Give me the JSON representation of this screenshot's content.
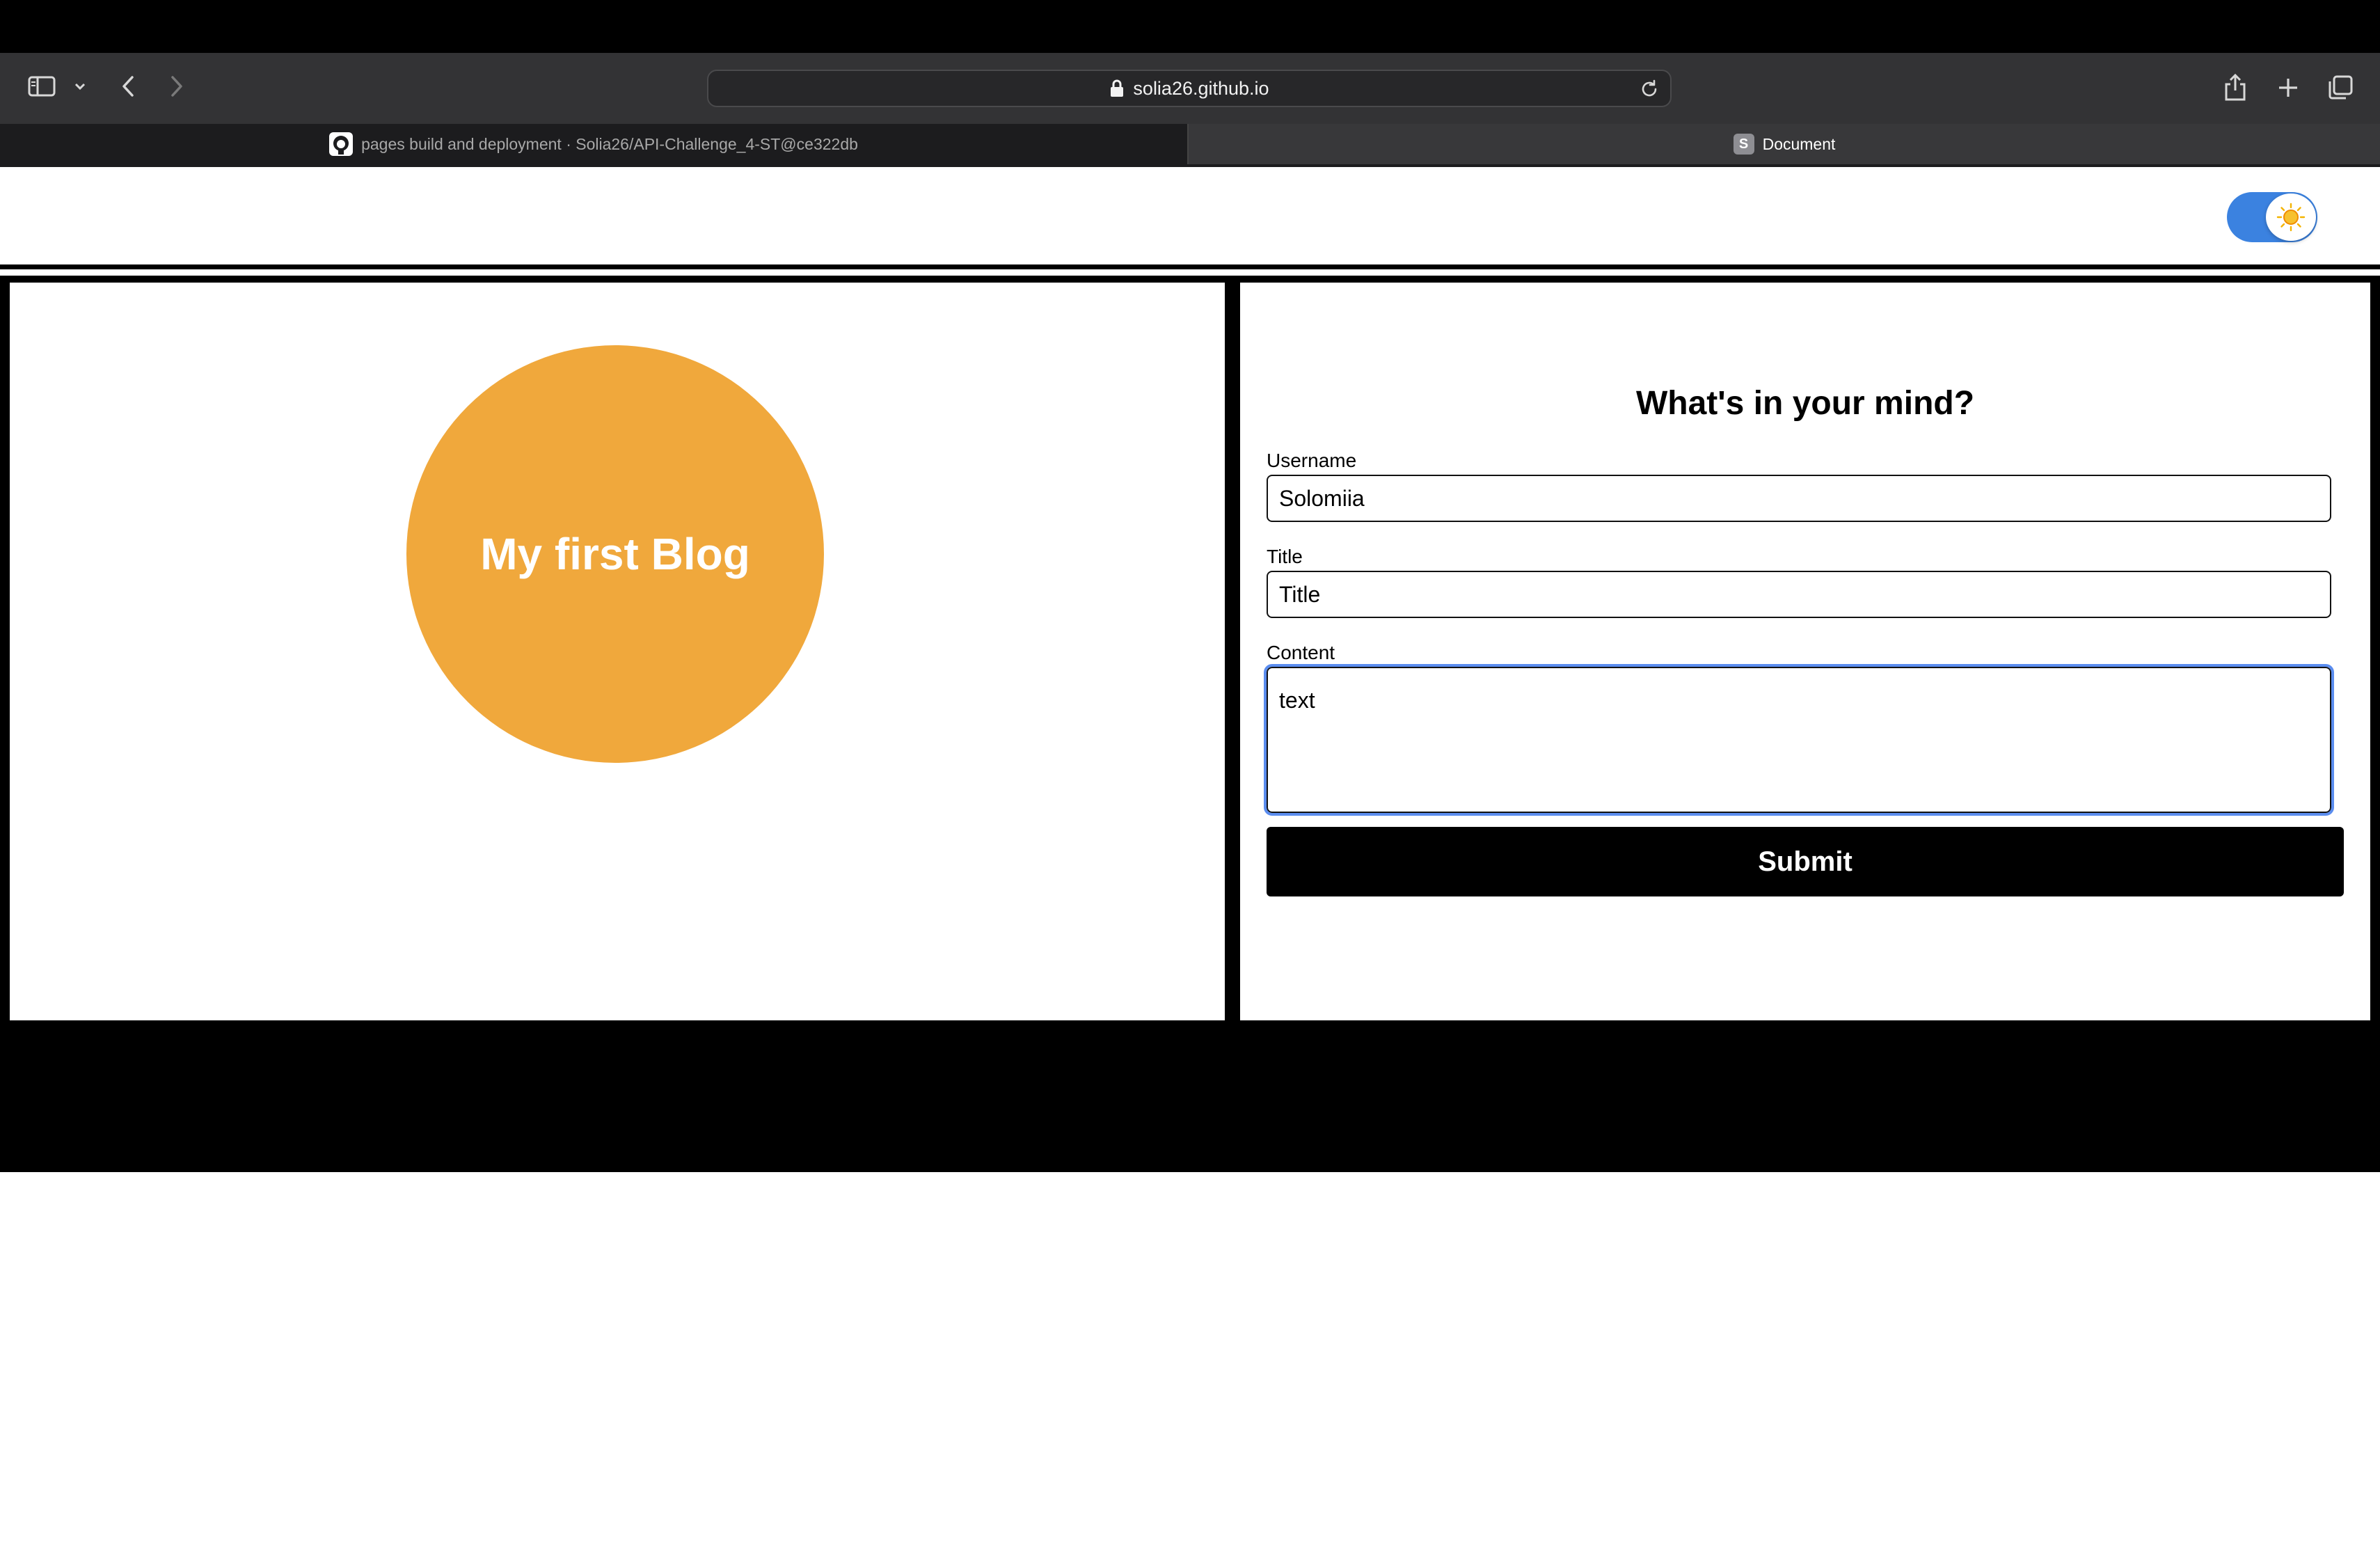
{
  "browser": {
    "url": "solia26.github.io",
    "tabs": [
      {
        "title": "pages build and deployment · Solia26/API-Challenge_4-ST@ce322db",
        "icon": "github-icon",
        "active": false
      },
      {
        "title": "Document",
        "favicon_letter": "S",
        "active": true
      }
    ]
  },
  "page": {
    "theme_toggle": {
      "state": "light",
      "icon": "sun-icon",
      "accent": "#3b82e0"
    },
    "hero": {
      "title": "My first Blog",
      "color": "#f0a83c"
    },
    "form": {
      "heading": "What's in your mind?",
      "username_label": "Username",
      "username_value": "Solomiia",
      "title_label": "Title",
      "title_value": "Title",
      "content_label": "Content",
      "content_value": "text",
      "submit_label": "Submit"
    }
  }
}
